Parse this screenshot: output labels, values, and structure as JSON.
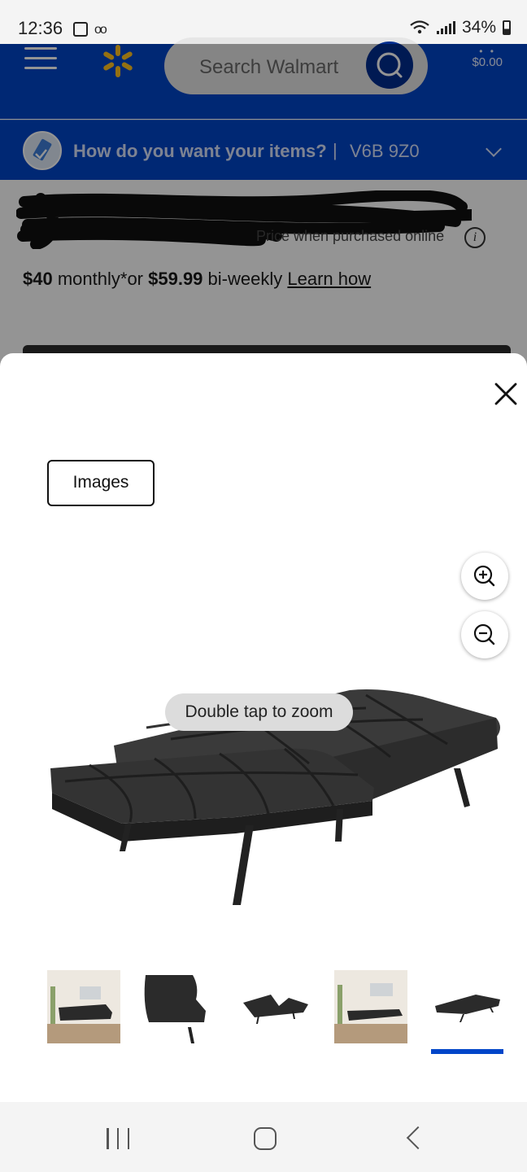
{
  "status_bar": {
    "time": "12:36",
    "battery": "34%",
    "icons": [
      "gallery-icon",
      "voicemail-icon",
      "wifi-icon",
      "signal-icon",
      "battery-icon"
    ]
  },
  "header": {
    "search_placeholder": "Search Walmart",
    "cart_total": "$0.00",
    "brand_color": "#0145c9",
    "spark_color": "#ffc220"
  },
  "delivery": {
    "prompt": "How do you want your items?",
    "separator": "|",
    "postal_code": "V6B 9Z0"
  },
  "product": {
    "price_note": "Price when purchased online",
    "payment": {
      "monthly_amount": "$40",
      "monthly_text": "monthly*or",
      "biweekly_amount": "$59.99",
      "biweekly_text": "bi-weekly",
      "learn_link": "Learn how"
    }
  },
  "viewer": {
    "tab_label": "Images",
    "hint": "Double tap to zoom",
    "active_thumbnail": 5,
    "thumbnails": [
      {
        "id": "thumb-1",
        "alt": "futon in living room"
      },
      {
        "id": "thumb-2",
        "alt": "futon side close-up"
      },
      {
        "id": "thumb-3",
        "alt": "futon reclined"
      },
      {
        "id": "thumb-4",
        "alt": "futon flat in living room"
      },
      {
        "id": "thumb-5",
        "alt": "futon flat bed"
      }
    ],
    "accent_color": "#0145c9"
  },
  "nav_bar": {
    "buttons": [
      "recent-apps",
      "home",
      "back"
    ]
  }
}
